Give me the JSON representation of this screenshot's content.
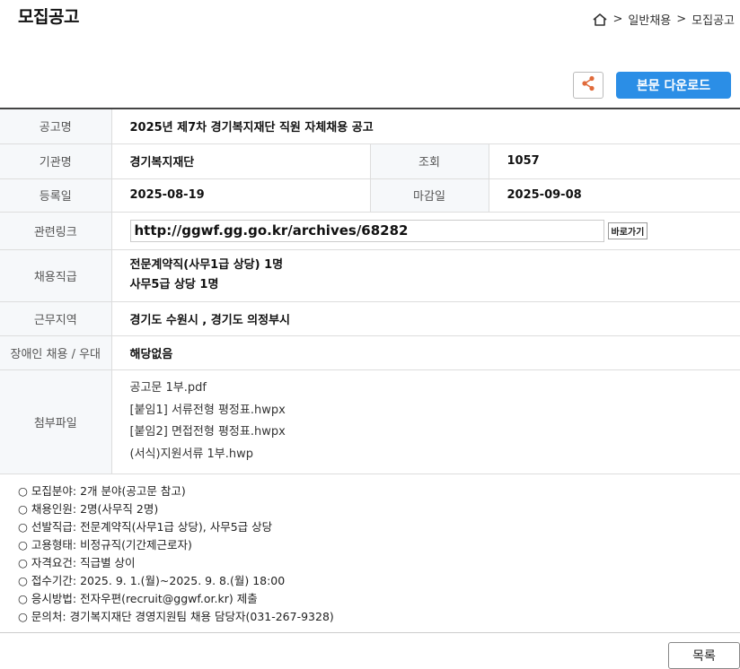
{
  "page": {
    "title": "모집공고",
    "breadcrumb": [
      ">",
      "일반채용",
      ">",
      "모집공고"
    ]
  },
  "actions": {
    "download_label": "본문 다운로드",
    "list_label": "목록"
  },
  "details": {
    "title_label": "공고명",
    "title_value": "2025년 제7차 경기복지재단 직원 자체채용 공고",
    "org_label": "기관명",
    "org_value": "경기복지재단",
    "views_label": "조회",
    "views_value": "1057",
    "reg_label": "등록일",
    "reg_value": "2025-08-19",
    "deadline_label": "마감일",
    "deadline_value": "2025-09-08",
    "link_label": "관련링크",
    "link_value": "http://ggwf.gg.go.kr/archives/68282",
    "link_button": "바로가기",
    "position_label": "채용직급",
    "position_lines": [
      "전문계약직(사무1급 상당) 1명",
      "사무5급 상당 1명"
    ],
    "region_label": "근무지역",
    "region_value": "경기도 수원시 , 경기도 의정부시",
    "disability_label": "장애인 채용 / 우대",
    "disability_value": "해당없음",
    "files_label": "첨부파일",
    "files": [
      "공고문 1부.pdf",
      "[붙임1] 서류전형 평정표.hwpx",
      "[붙임2] 면접전형 평정표.hwpx",
      "(서식)지원서류 1부.hwp"
    ]
  },
  "notes": [
    "○ 모집분야: 2개 분야(공고문 참고)",
    "○ 채용인원: 2명(사무직 2명)",
    "○ 선발직급: 전문계약직(사무1급 상당), 사무5급 상당",
    "○ 고용형태: 비정규직(기간제근로자)",
    "○ 자격요건: 직급별 상이",
    "○ 접수기간: 2025. 9. 1.(월)~2025. 9. 8.(월) 18:00",
    "○ 응시방법: 전자우편(recruit@ggwf.or.kr) 제출",
    "○ 문의처: 경기복지재단 경영지원팀 채용 담당자(031-267-9328)"
  ],
  "colors": {
    "accent": "#2b8ee6",
    "share_icon": "#e06a3a"
  },
  "icons": {
    "home": "home-icon",
    "share": "share-icon"
  }
}
